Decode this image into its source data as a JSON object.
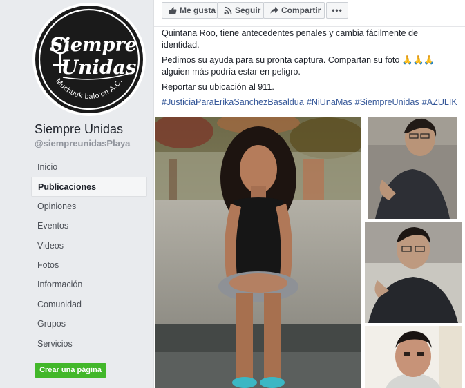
{
  "page": {
    "name": "Siempre Unidas",
    "handle": "@siempreunidasPlaya",
    "logo": {
      "line1": "Siempre",
      "line2": "Unidas",
      "subtitle": "Muchuuk balo'on A.C."
    }
  },
  "nav": {
    "items": [
      {
        "label": "Inicio"
      },
      {
        "label": "Publicaciones"
      },
      {
        "label": "Opiniones"
      },
      {
        "label": "Eventos"
      },
      {
        "label": "Videos"
      },
      {
        "label": "Fotos"
      },
      {
        "label": "Información"
      },
      {
        "label": "Comunidad"
      },
      {
        "label": "Grupos"
      },
      {
        "label": "Servicios"
      }
    ],
    "active": "Publicaciones"
  },
  "create_page_label": "Crear una página",
  "actions": {
    "like": {
      "label": "Me gusta",
      "icon": "thumbs-up-icon"
    },
    "follow": {
      "label": "Seguir",
      "icon": "rss-icon"
    },
    "share": {
      "label": "Compartir",
      "icon": "share-arrow-icon"
    },
    "more": {
      "label": "•••",
      "icon": "more-dots-icon"
    }
  },
  "post": {
    "line1": "Quintana Roo, tiene antecedentes penales y cambia fácilmente de",
    "line2": "identidad.",
    "line3": "Pedimos su ayuda para su pronta captura. Compartan su foto 🙏🙏🙏",
    "line4": "alguien más podría estar en peligro.",
    "line5": "Reportar su ubicación al 911.",
    "hashtags": [
      "#JusticiaParaErikaSanchezBasaldua",
      "#NiUnaMas",
      "#SiempreUnidas",
      "#AZULIK"
    ]
  },
  "colors": {
    "background": "#e9ebee",
    "link": "#365899",
    "create_button": "#42b72a",
    "text": "#1d2129"
  }
}
